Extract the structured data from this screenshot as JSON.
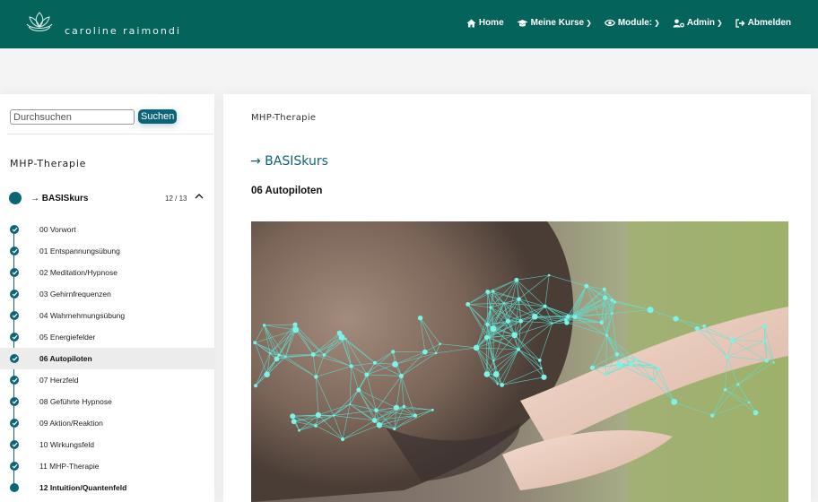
{
  "header": {
    "brand": "caroline raimondi",
    "nav": [
      {
        "label": "Home",
        "icon": "home-icon",
        "dropdown": false
      },
      {
        "label": "Meine Kurse",
        "icon": "graduation-cap-icon",
        "dropdown": true
      },
      {
        "label": "Module:",
        "icon": "eye-icon",
        "dropdown": true
      },
      {
        "label": "Admin",
        "icon": "users-cog-icon",
        "dropdown": true
      },
      {
        "label": "Abmelden",
        "icon": "sign-out-icon",
        "dropdown": false
      }
    ]
  },
  "sidebar": {
    "search_placeholder": "Durchsuchen",
    "search_button": "Suchen",
    "title": "MHP-Therapie",
    "course": {
      "name": "→ BASISkurs",
      "progress": "12 / 13",
      "completed": 12,
      "total": 13
    },
    "lessons": [
      {
        "label": "00 Vorwort",
        "done": true
      },
      {
        "label": "01 Entspannungsübung",
        "done": true
      },
      {
        "label": "02 Meditation/Hypnose",
        "done": true
      },
      {
        "label": "03 Gehirnfrequenzen",
        "done": true
      },
      {
        "label": "04 Wahrnehmungsübung",
        "done": true
      },
      {
        "label": "05 Energiefelder",
        "done": true
      },
      {
        "label": "06 Autopiloten",
        "done": true,
        "active": true
      },
      {
        "label": "07 Herzfeld",
        "done": true
      },
      {
        "label": "08 Geführte Hypnose",
        "done": true
      },
      {
        "label": "09 Aktion/Reaktion",
        "done": true
      },
      {
        "label": "10 Wirkungsfeld",
        "done": true
      },
      {
        "label": "11 MHP-Therapie",
        "done": true
      },
      {
        "label": "12 Intuition/Quantenfeld",
        "done": false
      }
    ]
  },
  "main": {
    "breadcrumb": "MHP-Therapie",
    "course_heading": "→ BASISkurs",
    "lesson_heading": "06 Autopiloten"
  },
  "colors": {
    "header_bg": "#04645c",
    "accent": "#0e6477",
    "active_row": "#ececec"
  }
}
